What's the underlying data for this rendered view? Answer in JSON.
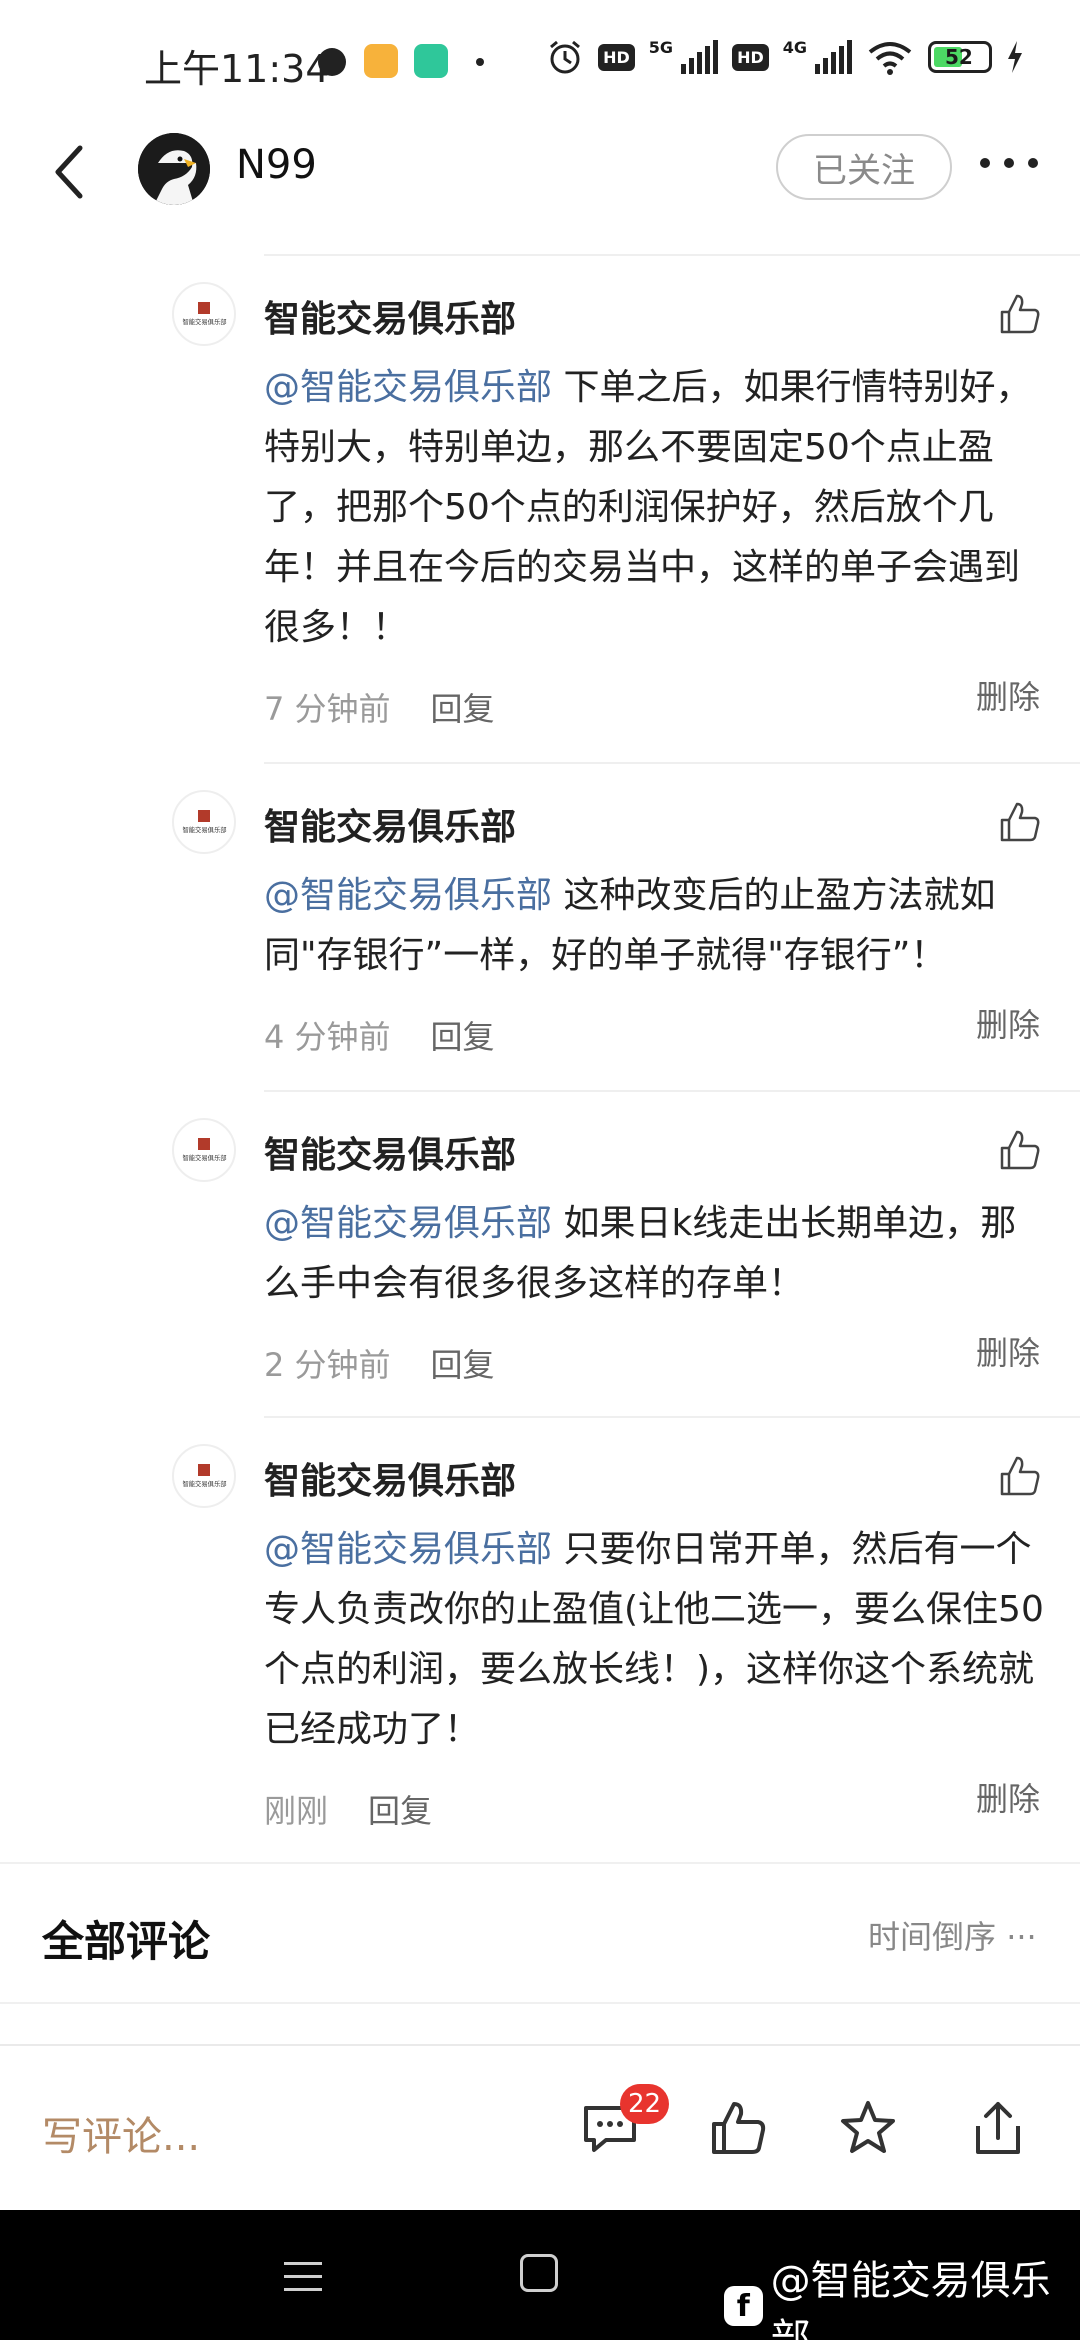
{
  "status_bar": {
    "time": "上午11:34",
    "network_1": "5G",
    "network_2": "4G",
    "hd_1": "HD",
    "hd_2": "HD",
    "battery": "52"
  },
  "header": {
    "username": "N99",
    "follow_label": "已关注"
  },
  "replies": [
    {
      "author": "智能交易俱乐部",
      "mention": "@智能交易俱乐部",
      "text": " 下单之后，如果行情特别好，特别大，特别单边，那么不要固定50个点止盈了，把那个50个点的利润保护好，然后放个几年！并且在今后的交易当中，这样的单子会遇到很多！！",
      "time": "7 分钟前",
      "reply_label": "回复",
      "delete_label": "删除"
    },
    {
      "author": "智能交易俱乐部",
      "mention": "@智能交易俱乐部",
      "text": " 这种改变后的止盈方法就如同\"存银行”一样，好的单子就得\"存银行”！",
      "time": "4 分钟前",
      "reply_label": "回复",
      "delete_label": "删除"
    },
    {
      "author": "智能交易俱乐部",
      "mention": "@智能交易俱乐部",
      "text": " 如果日k线走出长期单边，那么手中会有很多很多这样的存单！",
      "time": "2 分钟前",
      "reply_label": "回复",
      "delete_label": "删除"
    },
    {
      "author": "智能交易俱乐部",
      "mention": "@智能交易俱乐部",
      "text": " 只要你日常开单，然后有一个专人负责改你的止盈值(让他二选一，要么保住50个点的利润，要么放长线！)，这样你这个系统就已经成功了！",
      "time": "刚刚",
      "reply_label": "回复",
      "delete_label": "删除"
    }
  ],
  "comments_section": {
    "title": "全部评论",
    "sort_label": "时间倒序"
  },
  "action_bar": {
    "write_placeholder": "写评论...",
    "comment_count": "22"
  },
  "watermark": {
    "text": "@智能交易俱乐部"
  }
}
